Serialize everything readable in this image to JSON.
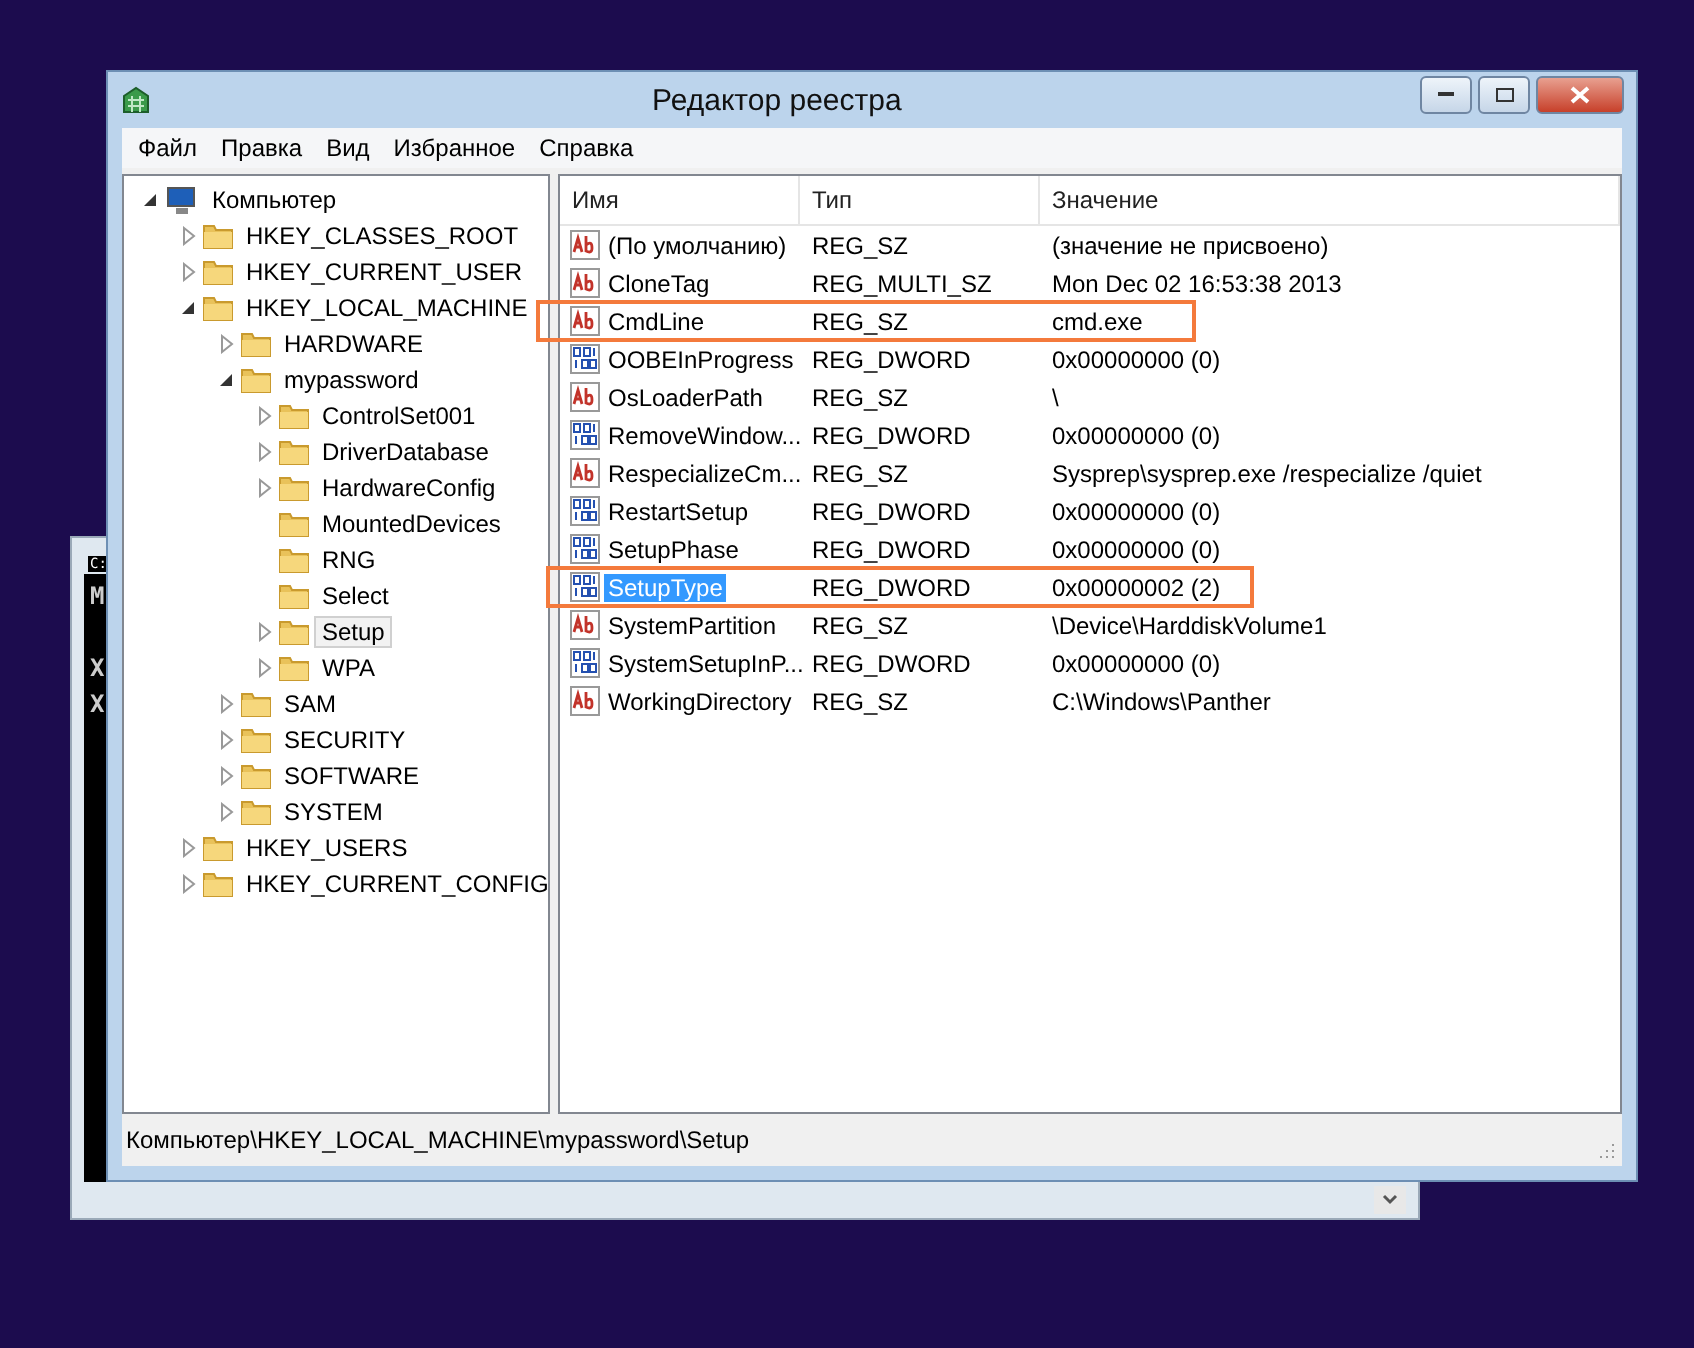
{
  "console_window": {
    "icon_text": "C:",
    "lines": [
      "M",
      "X",
      "X"
    ]
  },
  "window": {
    "title": "Редактор реестра"
  },
  "menu": [
    "Файл",
    "Правка",
    "Вид",
    "Избранное",
    "Справка"
  ],
  "tree": [
    {
      "label": "Компьютер",
      "kind": "computer",
      "expanded": true,
      "selected": false,
      "children": [
        {
          "label": "HKEY_CLASSES_ROOT",
          "expanded": false,
          "selected": false
        },
        {
          "label": "HKEY_CURRENT_USER",
          "expanded": false,
          "selected": false
        },
        {
          "label": "HKEY_LOCAL_MACHINE",
          "expanded": true,
          "selected": false,
          "children": [
            {
              "label": "HARDWARE",
              "expanded": false,
              "selected": false
            },
            {
              "label": "mypassword",
              "expanded": true,
              "selected": false,
              "children": [
                {
                  "label": "ControlSet001",
                  "expanded": false,
                  "selected": false
                },
                {
                  "label": "DriverDatabase",
                  "expanded": false,
                  "selected": false
                },
                {
                  "label": "HardwareConfig",
                  "expanded": false,
                  "selected": false
                },
                {
                  "label": "MountedDevices",
                  "selected": false
                },
                {
                  "label": "RNG",
                  "selected": false
                },
                {
                  "label": "Select",
                  "selected": false
                },
                {
                  "label": "Setup",
                  "expanded": false,
                  "selected": true
                },
                {
                  "label": "WPA",
                  "expanded": false,
                  "selected": false
                }
              ]
            },
            {
              "label": "SAM",
              "expanded": false,
              "selected": false
            },
            {
              "label": "SECURITY",
              "expanded": false,
              "selected": false
            },
            {
              "label": "SOFTWARE",
              "expanded": false,
              "selected": false
            },
            {
              "label": "SYSTEM",
              "expanded": false,
              "selected": false
            }
          ]
        },
        {
          "label": "HKEY_USERS",
          "expanded": false,
          "selected": false
        },
        {
          "label": "HKEY_CURRENT_CONFIG",
          "expanded": false,
          "selected": false
        }
      ]
    }
  ],
  "table": {
    "columns": [
      "Имя",
      "Тип",
      "Значение"
    ],
    "rows": [
      {
        "kind": "string",
        "name": "(По умолчанию)",
        "type": "REG_SZ",
        "value": "(значение не присвоено)",
        "selected": false,
        "highlighted": false
      },
      {
        "kind": "string",
        "name": "CloneTag",
        "type": "REG_MULTI_SZ",
        "value": "Mon Dec 02 16:53:38 2013",
        "selected": false,
        "highlighted": false
      },
      {
        "kind": "string",
        "name": "CmdLine",
        "type": "REG_SZ",
        "value": "cmd.exe",
        "selected": false,
        "highlighted": true
      },
      {
        "kind": "number",
        "name": "OOBEInProgress",
        "type": "REG_DWORD",
        "value": "0x00000000 (0)",
        "selected": false,
        "highlighted": false
      },
      {
        "kind": "string",
        "name": "OsLoaderPath",
        "type": "REG_SZ",
        "value": "\\",
        "selected": false,
        "highlighted": false
      },
      {
        "kind": "number",
        "name": "RemoveWindow...",
        "type": "REG_DWORD",
        "value": "0x00000000 (0)",
        "selected": false,
        "highlighted": false
      },
      {
        "kind": "string",
        "name": "RespecializeCm...",
        "type": "REG_SZ",
        "value": "Sysprep\\sysprep.exe /respecialize /quiet",
        "selected": false,
        "highlighted": false
      },
      {
        "kind": "number",
        "name": "RestartSetup",
        "type": "REG_DWORD",
        "value": "0x00000000 (0)",
        "selected": false,
        "highlighted": false
      },
      {
        "kind": "number",
        "name": "SetupPhase",
        "type": "REG_DWORD",
        "value": "0x00000000 (0)",
        "selected": false,
        "highlighted": false
      },
      {
        "kind": "number",
        "name": "SetupType",
        "type": "REG_DWORD",
        "value": "0x00000002 (2)",
        "selected": true,
        "highlighted": true
      },
      {
        "kind": "string",
        "name": "SystemPartition",
        "type": "REG_SZ",
        "value": "\\Device\\HarddiskVolume1",
        "selected": false,
        "highlighted": false
      },
      {
        "kind": "number",
        "name": "SystemSetupInP...",
        "type": "REG_DWORD",
        "value": "0x00000000 (0)",
        "selected": false,
        "highlighted": false
      },
      {
        "kind": "string",
        "name": "WorkingDirectory",
        "type": "REG_SZ",
        "value": "C:\\Windows\\Panther",
        "selected": false,
        "highlighted": false
      }
    ]
  },
  "status_bar": "Компьютер\\HKEY_LOCAL_MACHINE\\mypassword\\Setup"
}
